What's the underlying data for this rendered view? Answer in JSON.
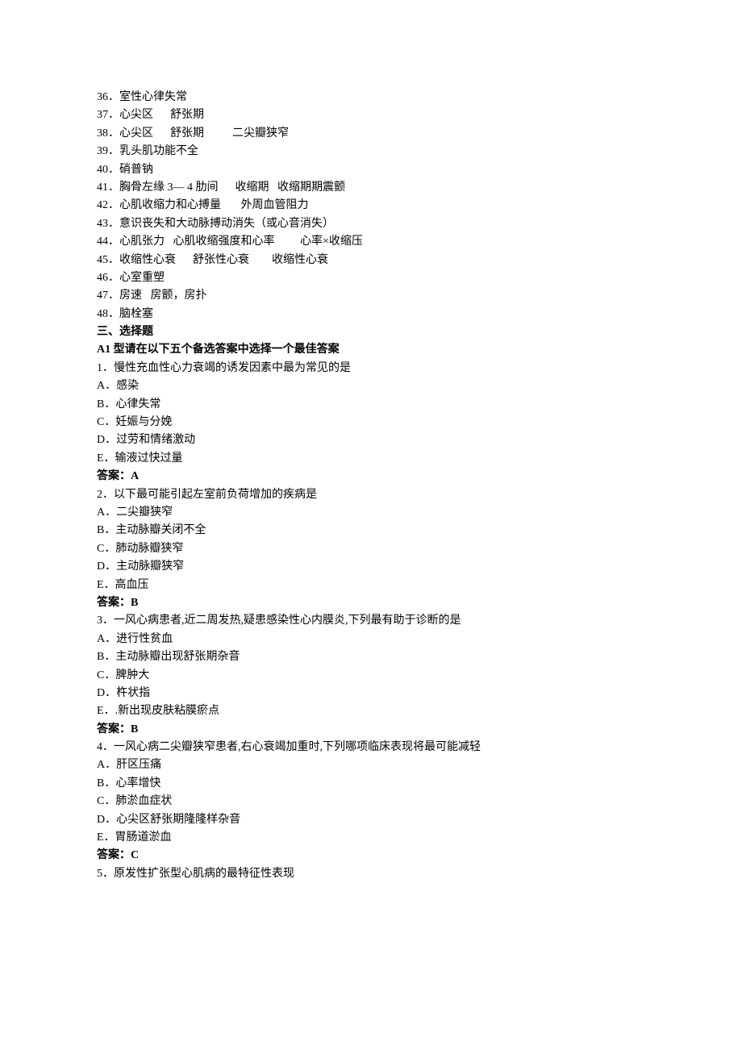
{
  "lines": [
    {
      "text": "36．室性心律失常",
      "bold": false
    },
    {
      "text": "37．心尖区      舒张期",
      "bold": false
    },
    {
      "text": "38．心尖区      舒张期          二尖瓣狭窄",
      "bold": false
    },
    {
      "text": "39．乳头肌功能不全",
      "bold": false
    },
    {
      "text": "40．硝普钠",
      "bold": false
    },
    {
      "text": "41．胸骨左缘 3— 4 肋间      收缩期   收缩期期震颤",
      "bold": false
    },
    {
      "text": "42．心肌收缩力和心搏量       外周血管阻力",
      "bold": false
    },
    {
      "text": "43．意识丧失和大动脉搏动消失（或心音消失）",
      "bold": false
    },
    {
      "text": "44．心肌张力   心肌收缩强度和心率         心率×收缩压",
      "bold": false
    },
    {
      "text": "45．收缩性心衰      舒张性心衰        收缩性心衰",
      "bold": false
    },
    {
      "text": "46．心室重塑",
      "bold": false
    },
    {
      "text": "47．房速   房颤，房扑",
      "bold": false
    },
    {
      "text": "48．脑栓塞",
      "bold": false
    },
    {
      "text": "三、选择题",
      "bold": true
    },
    {
      "text": "A1 型请在以下五个备选答案中选择一个最佳答案",
      "bold": true
    },
    {
      "text": "1．慢性充血性心力衰竭的诱发因素中最为常见的是",
      "bold": false
    },
    {
      "text": "A．感染",
      "bold": false
    },
    {
      "text": "B．心律失常",
      "bold": false
    },
    {
      "text": "C．妊娠与分娩",
      "bold": false
    },
    {
      "text": "D．过劳和情绪激动",
      "bold": false
    },
    {
      "text": "E．输液过快过量",
      "bold": false
    },
    {
      "text": "答案：A",
      "bold": true
    },
    {
      "text": "2．以下最可能引起左室前负荷增加的疾病是",
      "bold": false
    },
    {
      "text": "A．二尖瓣狭窄",
      "bold": false
    },
    {
      "text": "B．主动脉瓣关闭不全",
      "bold": false
    },
    {
      "text": "C．肺动脉瓣狭窄",
      "bold": false
    },
    {
      "text": "D．主动脉瓣狭窄",
      "bold": false
    },
    {
      "text": "E．高血压",
      "bold": false
    },
    {
      "text": "答案：B",
      "bold": true
    },
    {
      "text": "3．一风心病患者,近二周发热,疑患感染性心内膜炎,下列最有助于诊断的是",
      "bold": false
    },
    {
      "text": "A．进行性贫血",
      "bold": false
    },
    {
      "text": "B．主动脉瓣出现舒张期杂音",
      "bold": false
    },
    {
      "text": "C．脾肿大",
      "bold": false
    },
    {
      "text": "D．杵状指",
      "bold": false
    },
    {
      "text": "E．.新出现皮肤粘膜瘀点",
      "bold": false
    },
    {
      "text": "答案：B",
      "bold": true
    },
    {
      "text": "4．一风心病二尖瓣狭窄患者,右心衰竭加重时,下列哪项临床表现将最可能减轻",
      "bold": false
    },
    {
      "text": "A．肝区压痛",
      "bold": false
    },
    {
      "text": "B．心率增快",
      "bold": false
    },
    {
      "text": "C．肺淤血症状",
      "bold": false
    },
    {
      "text": "D．心尖区舒张期隆隆样杂音",
      "bold": false
    },
    {
      "text": "E．胃肠道淤血",
      "bold": false
    },
    {
      "text": "答案：C",
      "bold": true
    },
    {
      "text": "5．原发性扩张型心肌病的最特征性表现",
      "bold": false
    }
  ]
}
